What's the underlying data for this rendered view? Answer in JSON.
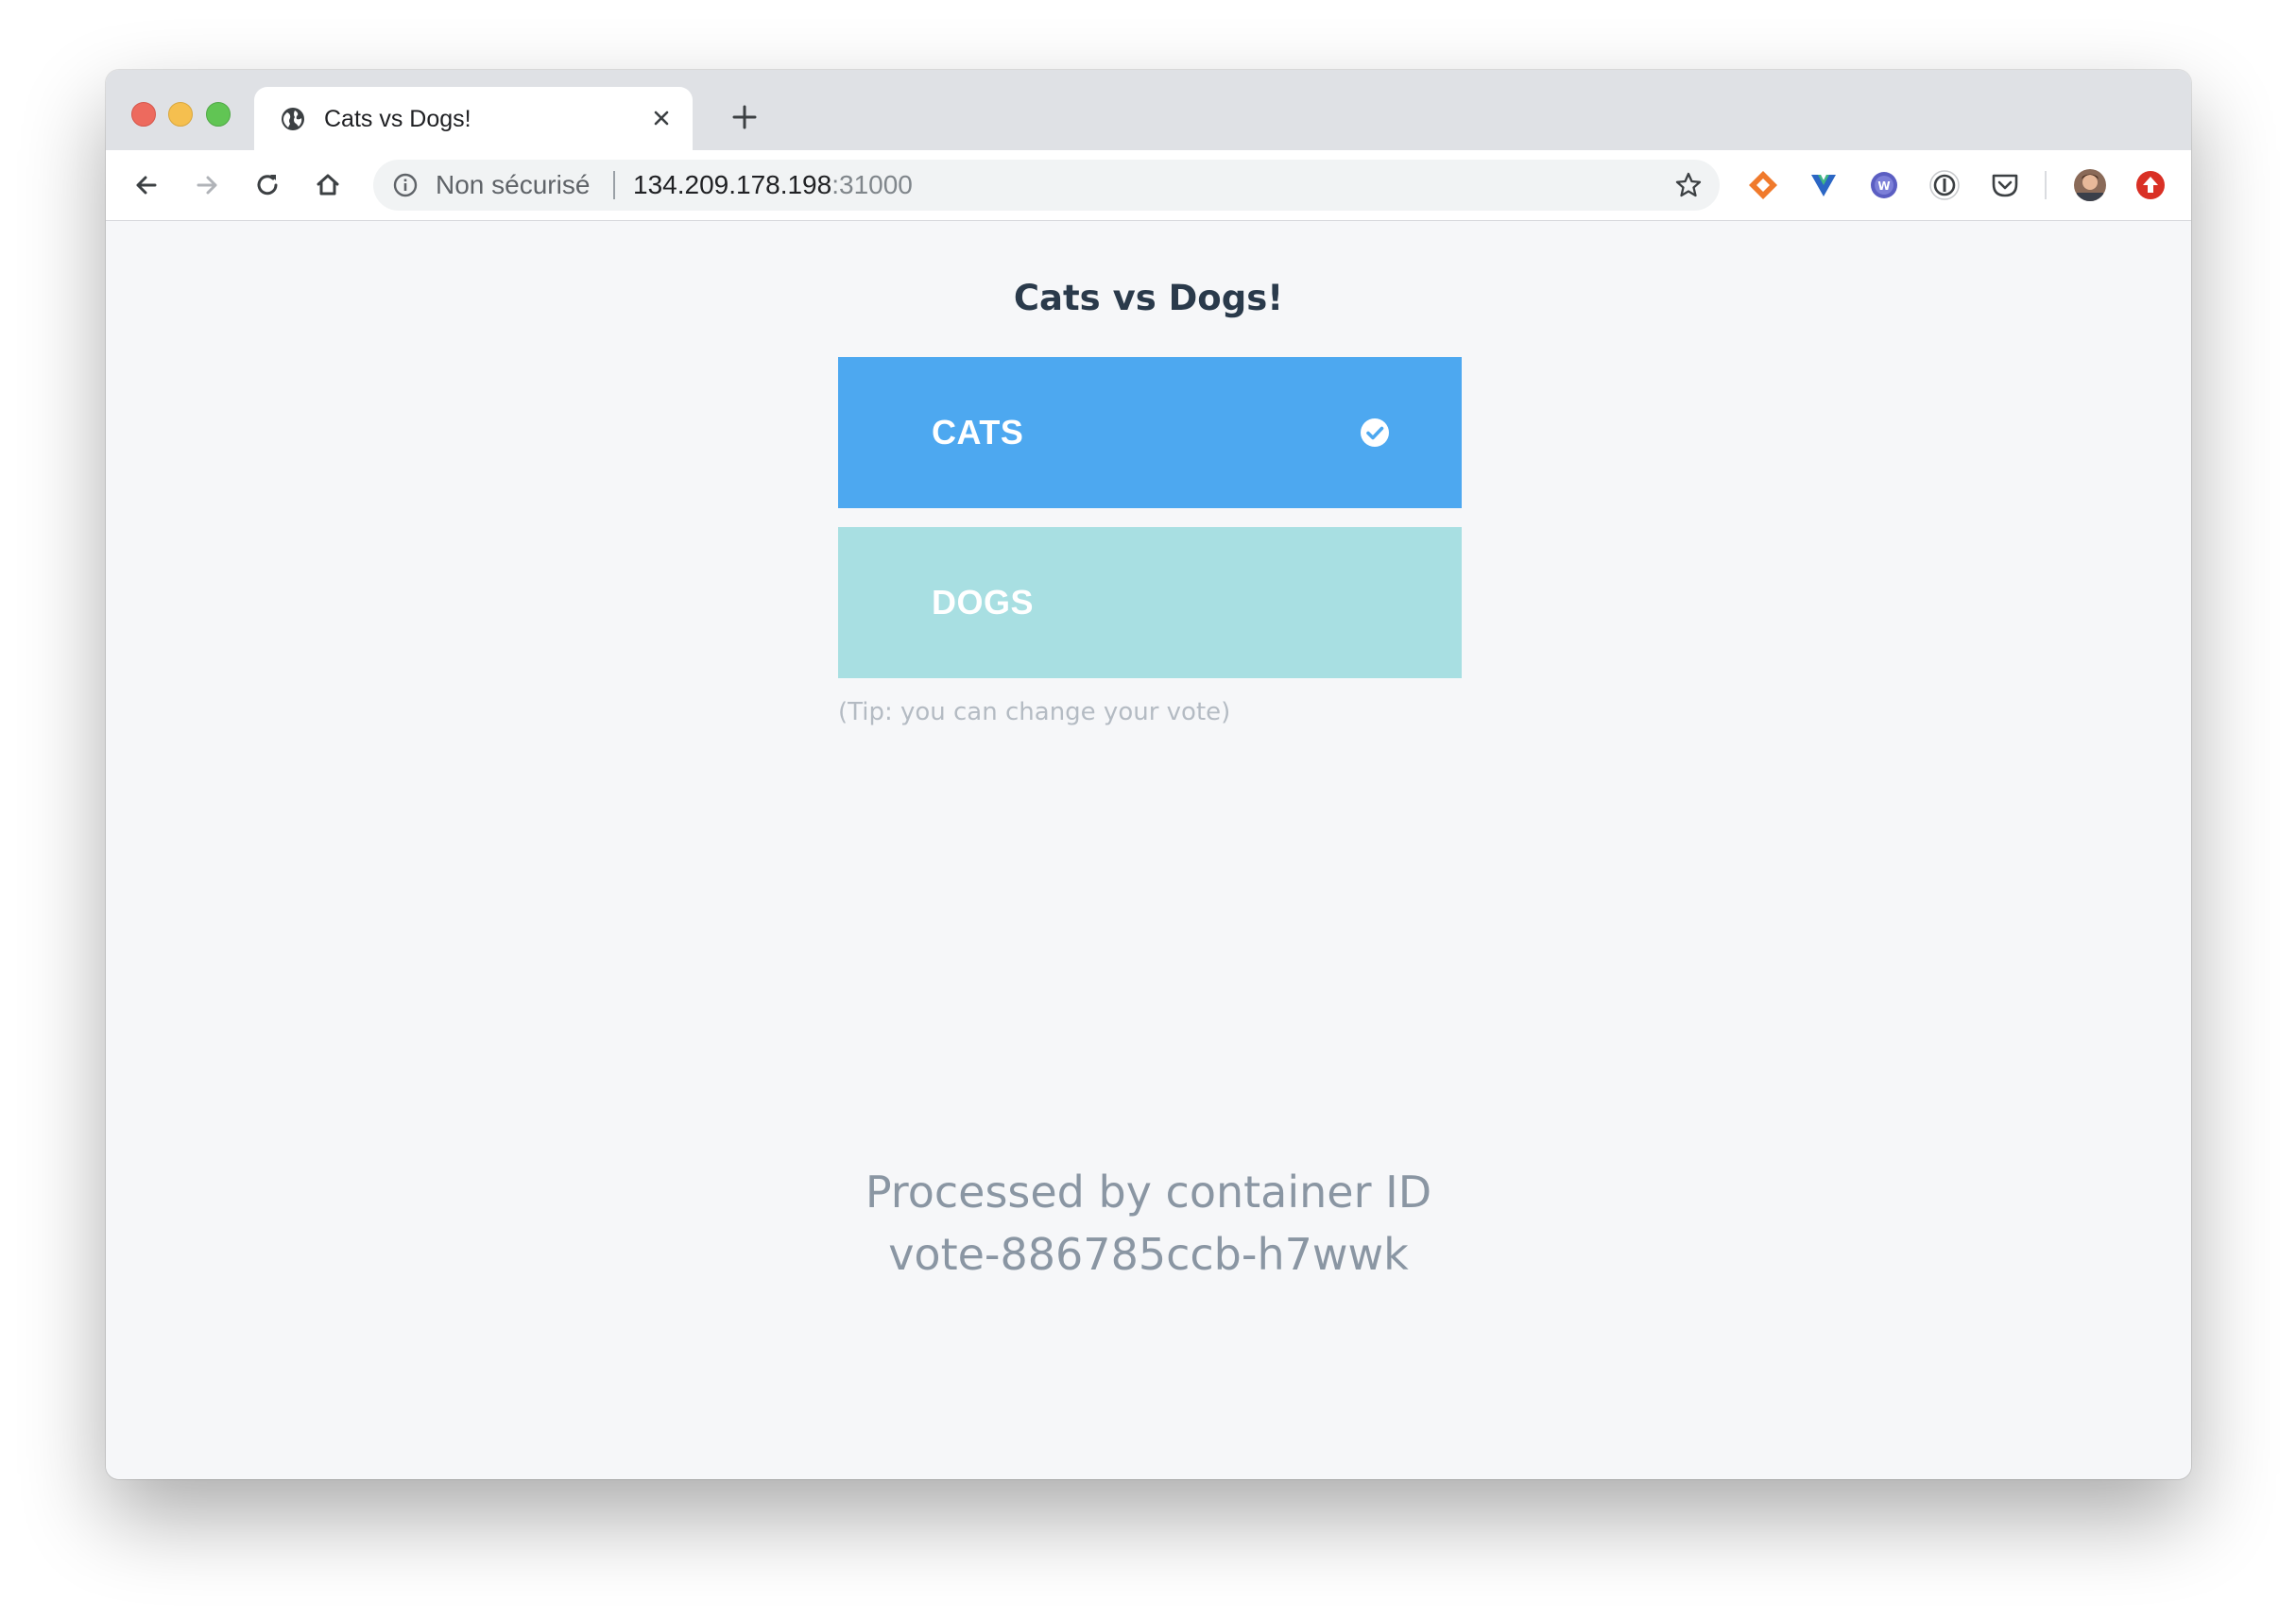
{
  "browser": {
    "tab": {
      "title": "Cats vs Dogs!"
    },
    "omnibox": {
      "security_label": "Non sécurisé",
      "host": "134.209.178.198",
      "port": ":31000"
    },
    "extensions": [
      "tag-extension-icon",
      "vue-devtools-icon",
      "wordpress-icon",
      "1password-icon",
      "pocket-icon",
      "profile-avatar",
      "update-icon"
    ]
  },
  "page": {
    "title": "Cats vs Dogs!",
    "options": [
      {
        "label": "CATS",
        "selected": true,
        "color": "#4da8f0"
      },
      {
        "label": "DOGS",
        "selected": false,
        "color": "#a8dfe2"
      }
    ],
    "tip": "(Tip: you can change your vote)",
    "processed_line1": "Processed by container ID",
    "processed_line2": "vote-886785ccb-h7wwk"
  }
}
